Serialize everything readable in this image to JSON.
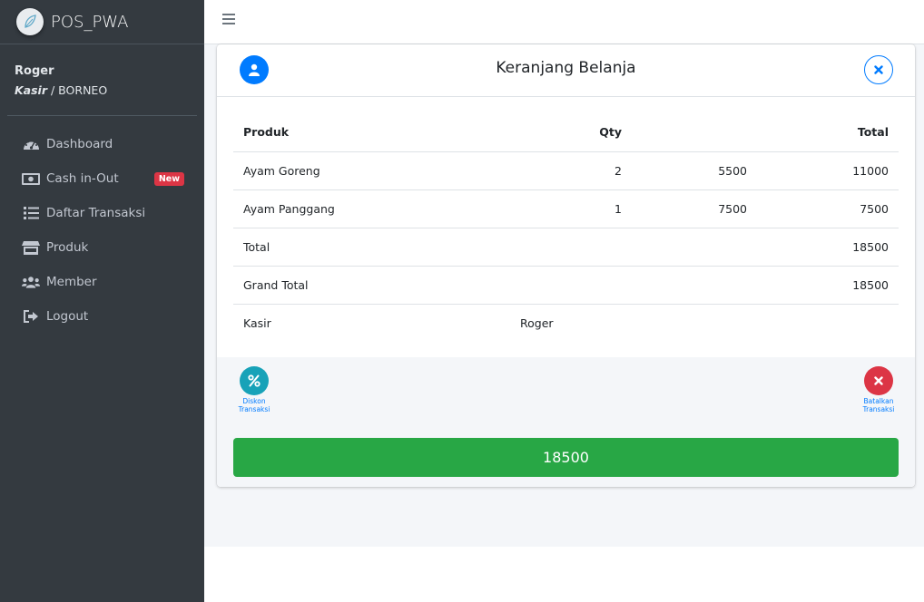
{
  "app": {
    "brand": "POS_PWA"
  },
  "user": {
    "name": "Roger",
    "role": "Kasir",
    "branch": "/ BORNEO"
  },
  "sidebar": {
    "items": [
      {
        "label": "Dashboard",
        "icon": "tachometer-icon"
      },
      {
        "label": "Cash in-Out",
        "icon": "money-bill-icon",
        "badge": "New"
      },
      {
        "label": "Daftar Transaksi",
        "icon": "list-icon"
      },
      {
        "label": "Produk",
        "icon": "store-icon"
      },
      {
        "label": "Member",
        "icon": "users-icon"
      },
      {
        "label": "Logout",
        "icon": "sign-out-icon"
      }
    ]
  },
  "cart": {
    "title": "Keranjang Belanja",
    "columns": {
      "product": "Produk",
      "qty": "Qty",
      "total": "Total"
    },
    "rows": [
      {
        "product": "Ayam Goreng",
        "qty": "2",
        "price": "5500",
        "total": "11000"
      },
      {
        "product": "Ayam Panggang",
        "qty": "1",
        "price": "7500",
        "total": "7500"
      }
    ],
    "summary": {
      "total_label": "Total",
      "total_value": "18500",
      "grand_label": "Grand Total",
      "grand_value": "18500",
      "cashier_label": "Kasir",
      "cashier_value": "Roger"
    },
    "actions": {
      "discount_line1": "Diskon",
      "discount_line2": "Transaksi",
      "cancel_line1": "Batalkan",
      "cancel_line2": "Transaksi"
    },
    "pay_button": "18500"
  },
  "colors": {
    "sidebar_bg": "#343a40",
    "primary": "#007bff",
    "success": "#28a745",
    "danger": "#dc3545",
    "info": "#17a2b8"
  }
}
